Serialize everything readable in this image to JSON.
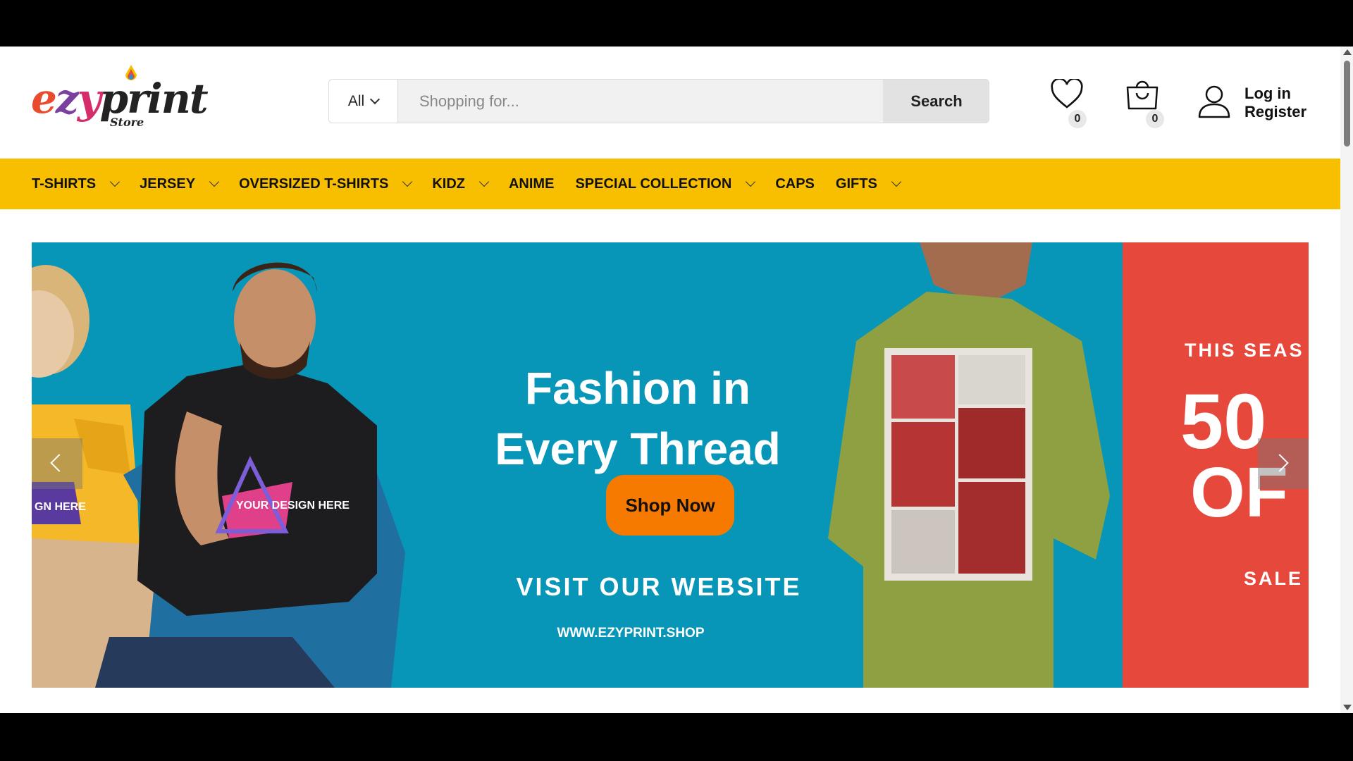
{
  "brand": {
    "logo_text": "ezyprint",
    "logo_sub": "Store"
  },
  "search": {
    "category": "All",
    "placeholder": "Shopping for...",
    "button_label": "Search"
  },
  "header_icons": {
    "wishlist_count": "0",
    "cart_count": "0",
    "login_label": "Log in",
    "register_label": "Register"
  },
  "nav": {
    "items": [
      {
        "label": "T-SHIRTS",
        "has_dropdown": true
      },
      {
        "label": "JERSEY",
        "has_dropdown": true
      },
      {
        "label": "OVERSIZED T-SHIRTS",
        "has_dropdown": true
      },
      {
        "label": "KIDZ",
        "has_dropdown": true
      },
      {
        "label": "ANIME",
        "has_dropdown": false
      },
      {
        "label": "SPECIAL COLLECTION",
        "has_dropdown": true
      },
      {
        "label": "CAPS",
        "has_dropdown": false
      },
      {
        "label": "GIFTS",
        "has_dropdown": true
      }
    ]
  },
  "banner": {
    "headline_line1": "Fashion in",
    "headline_line2": "Every Thread",
    "cta": "Shop Now",
    "visit_text": "VISIT OUR WEBSITE",
    "url_text": "WWW.EZYPRINT.SHOP",
    "shirt_print": "YOUR DESIGN HERE",
    "side_shirt_print": "GN HERE",
    "next_slide": {
      "line1": "THIS SEAS",
      "line2": "50",
      "line3": "OF",
      "line4": "SALE"
    }
  },
  "colors": {
    "nav_bg": "#f7bf00",
    "banner_bg": "#0796b8",
    "cta_bg": "#f77a00",
    "next_slide_bg": "#e6483b"
  }
}
